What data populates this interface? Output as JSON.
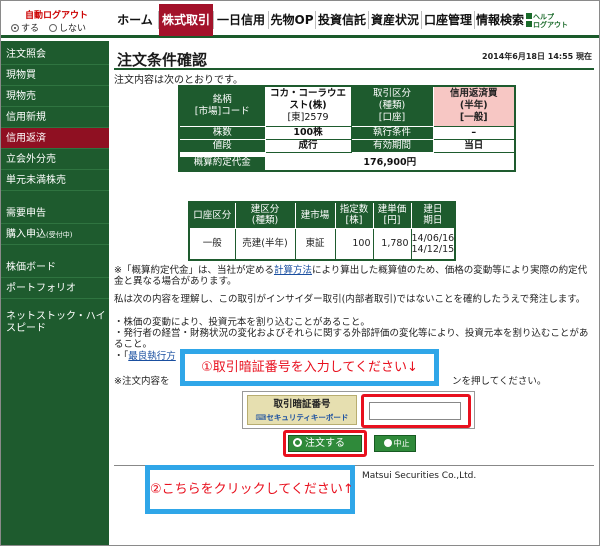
{
  "auto_logout": {
    "title": "自動ログアウト",
    "on_label": "する",
    "off_label": "しない",
    "selected": "する"
  },
  "nav": {
    "tabs": [
      "ホーム",
      "株式取引",
      "一日信用",
      "先物OP",
      "投資信託",
      "資産状況",
      "口座管理",
      "情報検索"
    ],
    "active": "株式取引",
    "help_label": "ヘルプ",
    "logout_label": "ログアウト"
  },
  "sidebar": {
    "items": [
      {
        "label": "注文照会"
      },
      {
        "label": "現物買"
      },
      {
        "label": "現物売"
      },
      {
        "label": "信用新規"
      },
      {
        "label": "信用返済",
        "active": true
      },
      {
        "label": "立会外分売"
      },
      {
        "label": "単元未満株売"
      },
      {
        "label": "需要申告"
      },
      {
        "label": "購入申込",
        "suffix": "(受付中)"
      },
      {
        "label": "株価ボード"
      },
      {
        "label": "ポートフォリオ"
      },
      {
        "label": "ネットストック・ハイスピード"
      }
    ]
  },
  "page": {
    "title": "注文条件確認",
    "datetime": "2014年6月18日 14:55 現在",
    "intro": "注文内容は次のとおりです。"
  },
  "order": {
    "stock_header": "銘柄\n[市場]コード",
    "stock_name": "コカ・コーラウエスト(株)",
    "stock_code": "[東]2579",
    "trade_type_header": "取引区分\n(種類)\n[口座]",
    "trade_type_value": "信用返済買\n(半年)\n[一般]",
    "rows": [
      {
        "label": "株数",
        "value": "100株",
        "label2": "執行条件",
        "value2": "–"
      },
      {
        "label": "値段",
        "value": "成行",
        "label2": "有効期間",
        "value2": "当日"
      }
    ],
    "estimate_label": "概算約定代金",
    "estimate_value": "176,900円"
  },
  "positions": {
    "headers": [
      "口座区分",
      "建区分\n(種類)",
      "建市場",
      "指定数\n[株]",
      "建単価\n[円]",
      "建日\n期日"
    ],
    "rows": [
      {
        "account": "一般",
        "type": "売建(半年)",
        "market": "東証",
        "qty": "100",
        "price": "1,780",
        "dates": "14/06/16\n14/12/15"
      }
    ]
  },
  "notes": {
    "note1_prefix": "※「概算約定代金」は、当社が定める",
    "note1_link": "計算方法",
    "note1_suffix": "により算出した概算値のため、価格の変動等により実際の約定代金と異なる場合があります。",
    "note2": "私は次の内容を理解し、この取引がインサイダー取引(内部者取引)ではないことを確約したうえで発注します。",
    "bullet1": "・株価の変動により、投資元本を割り込むことがあること。",
    "bullet2": "・発行者の経営・財務状況の変化およびそれらに関する外部評価の変化等により、投資元本を割り込むことがあること。",
    "bullet3_prefix": "・「",
    "bullet3_link": "最良執行方",
    "note3_prefix": "※注文内容を",
    "note3_suffix": "ンを押してください。"
  },
  "security": {
    "label": "取引暗証番号",
    "keyboard_label": "セキュリティキーボード",
    "input_value": ""
  },
  "buttons": {
    "order": "注文する",
    "cancel": "中止"
  },
  "footer": {
    "copyright": "Matsui Securities Co.,Ltd."
  },
  "callouts": {
    "step1": "①取引暗証番号を入力してください↓",
    "step2": "②こちらをクリックしてください↑"
  },
  "colors": {
    "nav_green": "#1e5b2e",
    "active_red": "#a3122a",
    "callout_border": "#2fa6e8",
    "callout_text": "#e8101e"
  }
}
